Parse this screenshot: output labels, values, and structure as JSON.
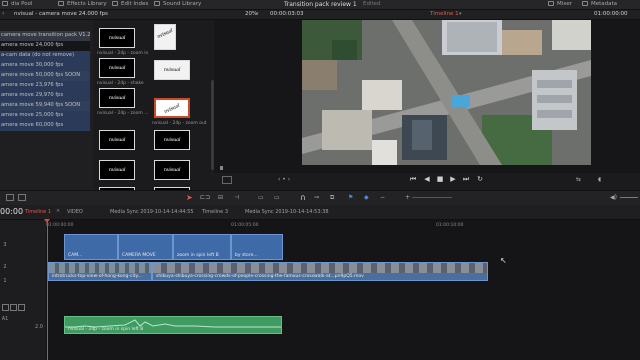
{
  "topbar": {
    "media_pool": "dia Pool",
    "effects_library": "Effects Library",
    "edit_index": "Edit Index",
    "sound_library": "Sound Library",
    "project_title": "Transition pack review 1",
    "edited": "Edited",
    "mixer": "Mixer",
    "metadata": "Metadata"
  },
  "secondbar": {
    "bin_name": "nvisual - camera move 24.000 fps",
    "zoom": "20%",
    "source_tc": "00:00:03:03",
    "timeline_name": "Timeline 1",
    "record_tc": "01:00:00:00"
  },
  "clip_list": [
    "camera move transition pack V1.2",
    "amera move 24,000 fps",
    "a-cam data (do not remove)",
    "amera move 30,000 fps",
    "amera move 50,000 fps SOON",
    "amera move 23,976 fps",
    "amera move 29,970 fps",
    "amera move 59,940 fps SOON",
    "amera move 25,000 fps",
    "amera move 60,000 fps"
  ],
  "media_labels": [
    "nvisual - 24p - zoom in",
    "",
    "nvisual - 24p - shake",
    "",
    "nvisual - 24p - zoom ...",
    "nvisual - 24p - zoom out",
    "",
    "",
    "",
    ""
  ],
  "thumb_brand": "nvisual",
  "timeline_tabs": {
    "tc": "00:00",
    "timeline1": "Timeline 1",
    "video": "VIDEO",
    "sync1": "Media Sync 2019-10-14-14:44:55",
    "timeline3": "Timeline 3",
    "sync2": "Media Sync 2019-10-14-14:53:38"
  },
  "ruler": {
    "t1": "01:00:00:00",
    "t2": "01:00:05:00",
    "t3": "01:00:10:00"
  },
  "tracks": {
    "v3": "3",
    "v2": "2",
    "v1": "1",
    "a1": "A1",
    "a1_num": "2.0"
  },
  "clips": {
    "c1": "CAM...",
    "c2": "CAMERA MOVE",
    "c3": "zoom in spin left B",
    "c4": "by store...",
    "v1a": "introtrucks-top-view-of-hong-kong-city...",
    "v1b": "shibuya-shibuya-crossing-crowds-of-people-crossing-the-famous-crosswalk-at...pn9pQ5.mov",
    "audio": "nvisual - 24p - zoom in spin left B"
  },
  "colors": {
    "accent": "#e05a4a",
    "video_clip": "#3f6aa8",
    "audio_clip": "#3f9b62",
    "selected_row": "#2a3a58"
  }
}
